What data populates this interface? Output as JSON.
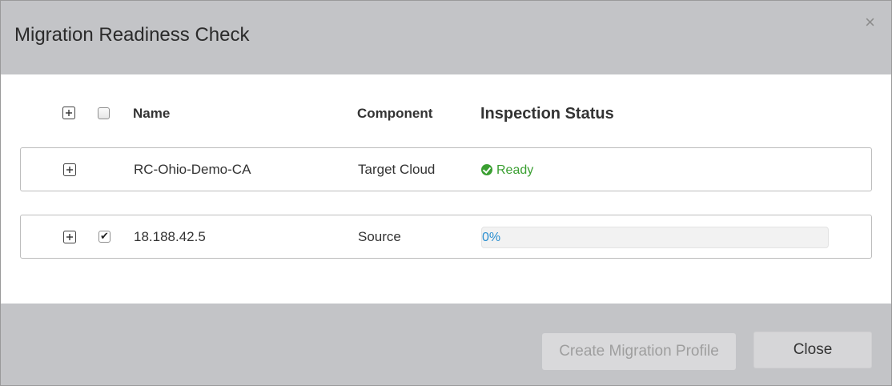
{
  "dialog": {
    "title": "Migration Readiness Check",
    "close_glyph": "×"
  },
  "table": {
    "headers": {
      "name": "Name",
      "component": "Component",
      "status": "Inspection Status"
    },
    "rows": [
      {
        "name": "RC-Ohio-Demo-CA",
        "component": "Target Cloud",
        "checked": false,
        "status": {
          "type": "ready",
          "label": "Ready",
          "icon": "check-circle-icon"
        }
      },
      {
        "name": "18.188.42.5",
        "component": "Source",
        "checked": true,
        "status": {
          "type": "progress",
          "label": "0%",
          "progress": 0
        }
      }
    ]
  },
  "footer": {
    "create_label": "Create Migration Profile",
    "close_label": "Close"
  },
  "colors": {
    "header_bg": "#c3c4c7",
    "ready_green": "#3a9f31",
    "progress_text": "#2a8fd0"
  }
}
